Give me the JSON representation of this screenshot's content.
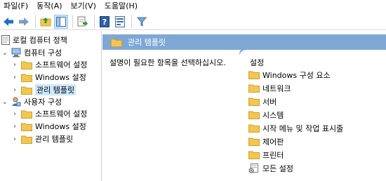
{
  "menu": [
    "파일(F)",
    "동작(A)",
    "보기(V)",
    "도움말(H)"
  ],
  "toolbar": {
    "buttons": [
      "back-arrow-icon",
      "forward-arrow-icon",
      "up-folder-icon",
      "show-hide-tree-icon",
      "export-list-icon",
      "help-icon",
      "properties-icon",
      "filter-icon"
    ]
  },
  "tree": {
    "root": "로컬 컴퓨터 정책",
    "computer_config": "컴퓨터 구성",
    "computer_children": [
      "소프트웨어 설정",
      "Windows 설정",
      "관리 템플릿"
    ],
    "user_config": "사용자 구성",
    "user_children": [
      "소프트웨어 설정",
      "Windows 설정",
      "관리 템플릿"
    ]
  },
  "right": {
    "header": "관리 템플릿",
    "description": "설명이 필요한 항목을 선택하십시오.",
    "column": "설정",
    "items": [
      "Windows 구성 요소",
      "네트워크",
      "서버",
      "시스템",
      "시작 메뉴 및 작업 표시줄",
      "제어판",
      "프린터",
      "모든 설정"
    ]
  },
  "colors": {
    "header_bg": "#7fa7d6",
    "selection": "#cce8ff",
    "folder": "#f3c64d"
  }
}
